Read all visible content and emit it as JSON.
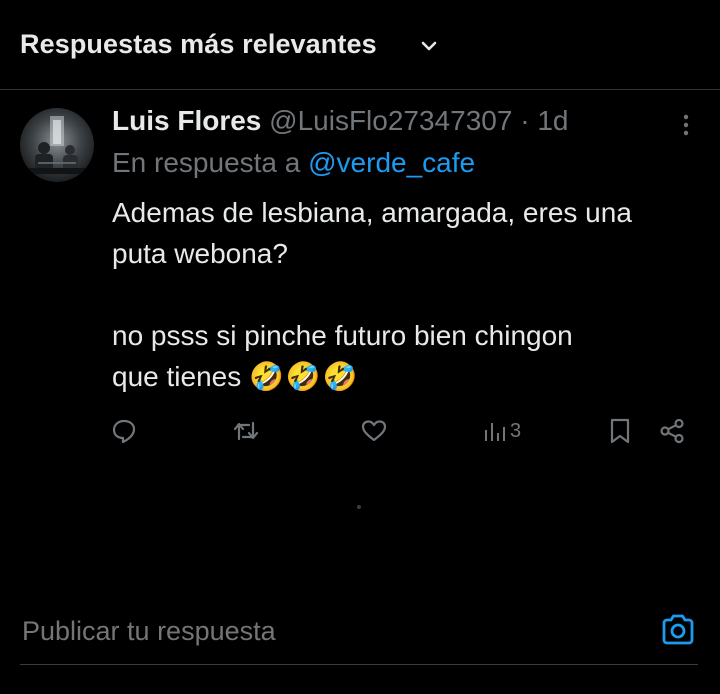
{
  "header": {
    "sort_label": "Respuestas más relevantes",
    "chevron_icon": "chevron-down-icon"
  },
  "tweet": {
    "author_name": "Luis Flores",
    "author_handle": "@LuisFlo27347307",
    "separator": "·",
    "timestamp": "1d",
    "reply_prefix": "En respuesta a",
    "reply_mention": "@verde_cafe",
    "text_line1": "Ademas de lesbiana, amargada, eres una",
    "text_line2": "puta webona?",
    "text_line3": "no psss si pinche futuro bien chingon",
    "text_line4": "que tienes",
    "emojis": "🤣🤣🤣",
    "actions": {
      "reply_icon": "reply-icon",
      "retweet_icon": "retweet-icon",
      "like_icon": "heart-icon",
      "views_icon": "views-icon",
      "views_count": "3",
      "bookmark_icon": "bookmark-icon",
      "share_icon": "share-icon"
    }
  },
  "composer": {
    "placeholder": "Publicar tu respuesta",
    "camera_icon": "camera-icon"
  },
  "colors": {
    "background": "#000000",
    "text_primary": "#e7e9ea",
    "text_secondary": "#71767b",
    "accent": "#1d9bf0",
    "divider": "#2f3336"
  }
}
